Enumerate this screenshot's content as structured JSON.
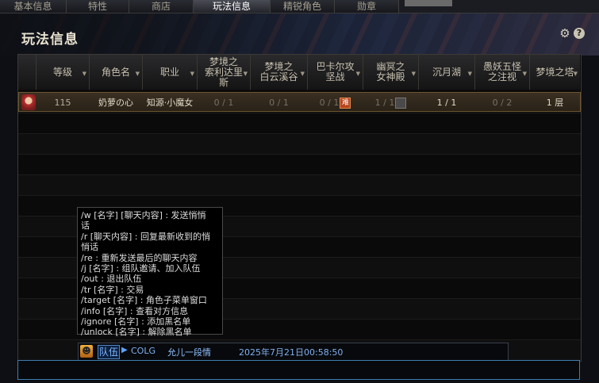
{
  "top_tabs": [
    "基本信息",
    "特性",
    "商店",
    "玩法信息",
    "精锐角色",
    "勋章"
  ],
  "active_tab": 3,
  "title": "玩法信息",
  "icons": {
    "settings": "gear-icon",
    "help": "help-icon",
    "help_glyph": "?",
    "settings_glyph": "⚙"
  },
  "columns": [
    "等级",
    "角色名",
    "职业",
    "梦境之索利达里斯",
    "梦境之白云溪谷",
    "巴卡尔攻坚战",
    "幽冥之女神殿",
    "沉月湖",
    "愚妖五怪之注视",
    "梦境之塔"
  ],
  "column_display": [
    "等级",
    "角色名",
    "职业",
    "梦境之\n索利达里\n斯",
    "梦境之\n白云溪谷",
    "巴卡尔攻\n坚战",
    "幽冥之\n女神殿",
    "沉月湖",
    "愚妖五怪\n之注视",
    "梦境之塔"
  ],
  "row": {
    "level": "115",
    "name": "奶萝の心",
    "job": "知源·小魔女",
    "c1": "0 / 1",
    "c2": "0 / 1",
    "c3": "0 / 1",
    "c3_badge": "难",
    "c4": "1 / 1",
    "c5": "1 / 1",
    "c6": "0 / 2",
    "c7": "1 层"
  },
  "tooltip_lines": [
    "/w [名字] [聊天内容] : 发送悄悄",
    "话",
    "/r [聊天内容] : 回复最新收到的悄",
    "悄话",
    "/re : 重新发送最后的聊天内容",
    "/j [名字] : 组队邀请、加入队伍",
    "/out : 退出队伍",
    "/tr [名字] : 交易",
    "/target [名字] : 角色子菜单窗口",
    "/info [名字] : 查看对方信息",
    "/ignore [名字] : 添加黑名单",
    "/unlock [名字] : 解除黑名单"
  ],
  "chat": {
    "channel": "队伍",
    "message_prefix": "COLG",
    "message": "允儿一段情",
    "timestamp": "2025年7月21日00:58:50"
  }
}
